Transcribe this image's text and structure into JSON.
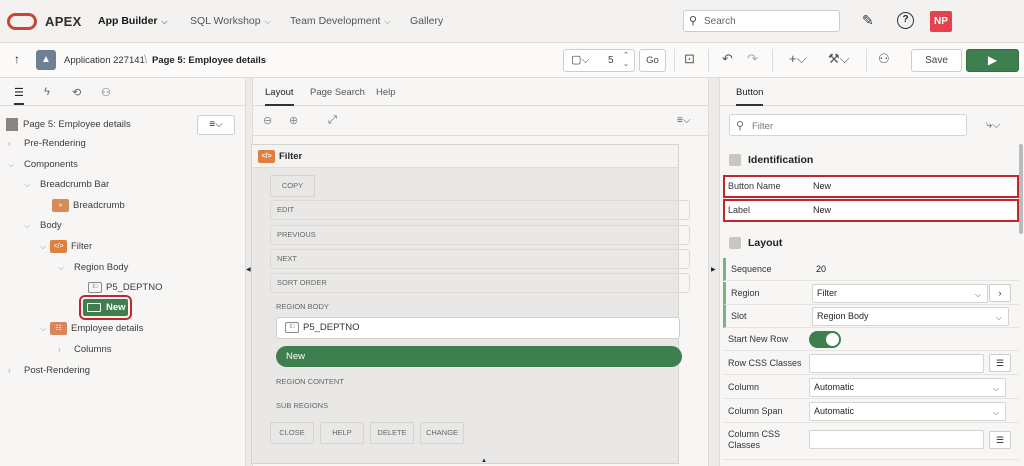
{
  "nav": {
    "brand": "APEX",
    "items": [
      {
        "label": "App Builder",
        "active": true,
        "dropdown": true
      },
      {
        "label": "SQL Workshop",
        "active": false,
        "dropdown": true
      },
      {
        "label": "Team Development",
        "active": false,
        "dropdown": true
      },
      {
        "label": "Gallery",
        "active": false,
        "dropdown": false
      }
    ],
    "search_placeholder": "Search",
    "avatar_initials": "NP"
  },
  "toolbar": {
    "app_crumb": "Application 227141",
    "page_crumb": "Page 5: Employee details",
    "page_number": "5",
    "go_label": "Go",
    "save_label": "Save"
  },
  "left": {
    "rows": [
      {
        "label": "Page 5: Employee details",
        "level": 0,
        "kind": "page"
      },
      {
        "label": "Pre-Rendering",
        "level": 0,
        "kind": "collapsed"
      },
      {
        "label": "Components",
        "level": 0,
        "kind": "expanded"
      },
      {
        "label": "Breadcrumb Bar",
        "level": 1,
        "kind": "expanded"
      },
      {
        "label": "Breadcrumb",
        "level": 2,
        "kind": "breadcrumb"
      },
      {
        "label": "Body",
        "level": 1,
        "kind": "expanded"
      },
      {
        "label": "Filter",
        "level": 2,
        "kind": "region"
      },
      {
        "label": "Region Body",
        "level": 3,
        "kind": "expanded"
      },
      {
        "label": "P5_DEPTNO",
        "level": 4,
        "kind": "item"
      },
      {
        "label": "New",
        "level": 4,
        "kind": "button-selected"
      },
      {
        "label": "Employee details",
        "level": 2,
        "kind": "report"
      },
      {
        "label": "Columns",
        "level": 3,
        "kind": "collapsed"
      },
      {
        "label": "Post-Rendering",
        "level": 0,
        "kind": "collapsed"
      }
    ]
  },
  "middle": {
    "tabs": [
      "Layout",
      "Page Search",
      "Help"
    ],
    "region_title": "Filter",
    "slots": [
      "COPY",
      "EDIT",
      "PREVIOUS",
      "NEXT",
      "SORT ORDER",
      "REGION BODY",
      "REGION CONTENT",
      "SUB REGIONS"
    ],
    "bottom_buttons": [
      "CLOSE",
      "HELP",
      "DELETE",
      "CHANGE"
    ],
    "item_label": "P5_DEPTNO",
    "button_label": "New"
  },
  "right": {
    "tab": "Button",
    "filter_placeholder": "Filter",
    "groups": {
      "identification": "Identification",
      "layout": "Layout"
    },
    "identification": [
      {
        "label": "Button Name",
        "value": "New"
      },
      {
        "label": "Label",
        "value": "New"
      }
    ],
    "layout": [
      {
        "label": "Sequence",
        "value": "20",
        "type": "text"
      },
      {
        "label": "Region",
        "value": "Filter",
        "type": "select"
      },
      {
        "label": "Slot",
        "value": "Region Body",
        "type": "select"
      },
      {
        "label": "Start New Row",
        "value": "",
        "type": "toggle"
      },
      {
        "label": "Row CSS Classes",
        "value": "",
        "type": "input"
      },
      {
        "label": "Column",
        "value": "Automatic",
        "type": "select"
      },
      {
        "label": "Column Span",
        "value": "Automatic",
        "type": "select"
      },
      {
        "label": "Column CSS Classes",
        "value": "",
        "type": "input"
      }
    ]
  },
  "colors": {
    "brand": "#c74634",
    "accent_green": "#3d7f4f",
    "highlight_red": "#c4262e",
    "avatar": "#e3424e"
  }
}
